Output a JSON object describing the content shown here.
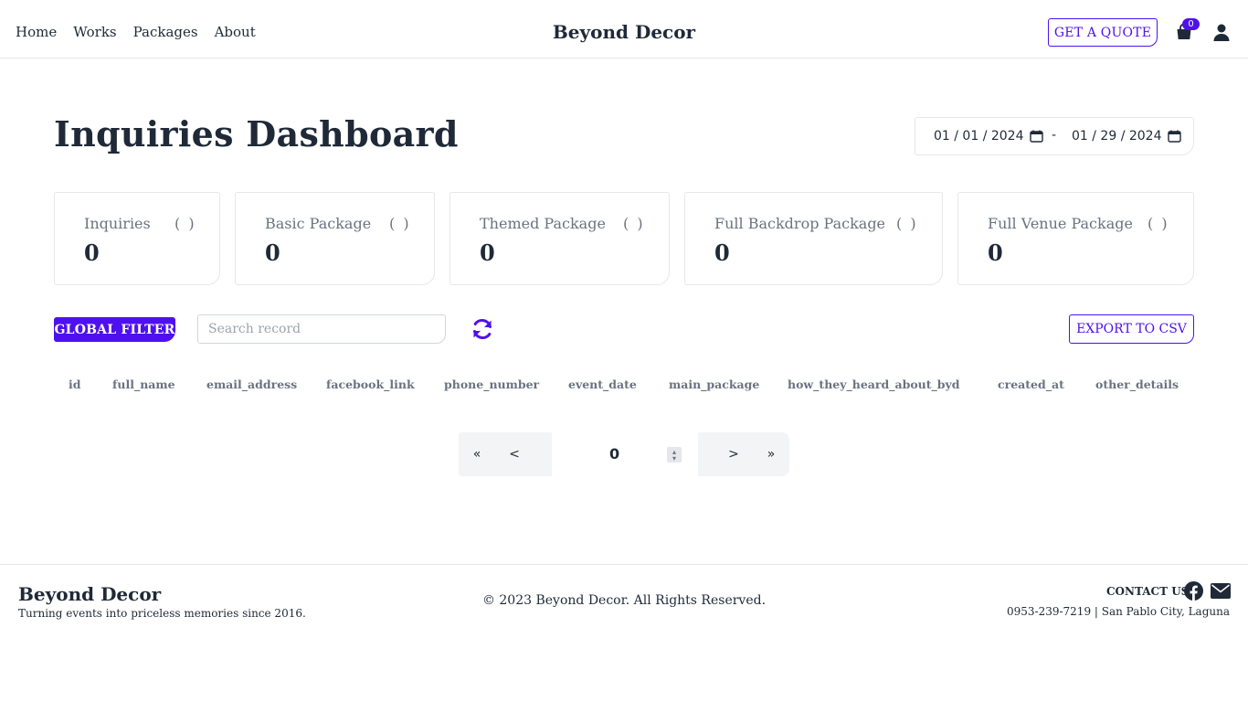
{
  "nav": {
    "links": [
      "Home",
      "Works",
      "Packages",
      "About"
    ],
    "brand": "Beyond Decor",
    "quote_label": "GET A QUOTE",
    "cart_count": "0",
    "icons": {
      "cart": "shopping-bag-icon",
      "user": "user-icon"
    }
  },
  "page": {
    "title": "Inquiries Dashboard"
  },
  "date_range": {
    "from": "01 / 01 / 2024",
    "separator": "-",
    "to": "01 / 29 / 2024"
  },
  "stats": [
    {
      "label": "Inquiries",
      "paren": "( )",
      "value": "0"
    },
    {
      "label": "Basic Package",
      "paren": "( )",
      "value": "0"
    },
    {
      "label": "Themed Package",
      "paren": "( )",
      "value": "0"
    },
    {
      "label": "Full Backdrop Package",
      "paren": "( )",
      "value": "0"
    },
    {
      "label": "Full Venue Package",
      "paren": "( )",
      "value": "0"
    }
  ],
  "toolbar": {
    "filter_label": "GLOBAL FILTER",
    "search_placeholder": "Search record",
    "export_label": "EXPORT TO CSV"
  },
  "table": {
    "columns": [
      "id",
      "full_name",
      "email_address",
      "facebook_link",
      "phone_number",
      "event_date",
      "main_package",
      "how_they_heard_about_byd",
      "created_at",
      "other_details"
    ]
  },
  "pagination": {
    "first": "«",
    "prev": "<",
    "page": "0",
    "next": ">",
    "last": "»"
  },
  "footer": {
    "brand": "Beyond Decor",
    "tagline": "Turning events into priceless memories since 2016.",
    "copyright": "© 2023 Beyond Decor. All Rights Reserved.",
    "contact_label": "CONTACT US",
    "address": "0953-239-7219 | San Pablo City, Laguna"
  },
  "colors": {
    "accent": "#4f10ee",
    "text": "#1f2937",
    "muted": "#6b7280",
    "border": "#e5e7eb"
  }
}
